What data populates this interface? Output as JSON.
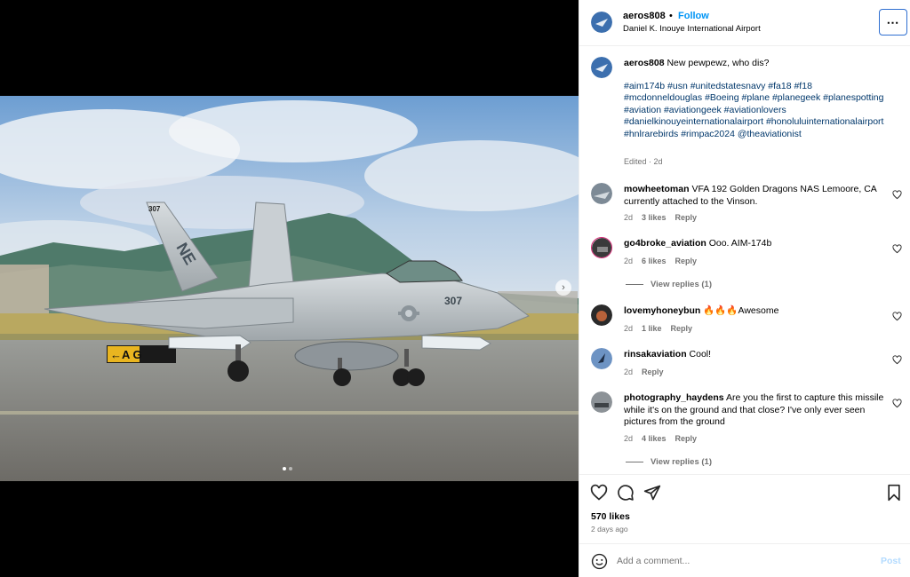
{
  "post": {
    "username": "aeros808",
    "separator": "•",
    "follow_label": "Follow",
    "location": "Daniel K. Inouye International Airport",
    "more_label": "⋯"
  },
  "caption": {
    "username": "aeros808",
    "text": "New pewpewz, who dis?",
    "hashtags": "#aim174b #usn #unitedstatesnavy #fa18 #f18 #mcdonneldouglas #Boeing #plane #planegeek #planespotting #aviation #aviationgeek #aviationlovers #danielkinouyeinternationalairport #honoluluinternationalairport #hnlrarebirds #rimpac2024 @theaviationist",
    "meta": "Edited · 2d"
  },
  "comments": [
    {
      "username": "mowheetoman",
      "text": "VFA 192 Golden Dragons NAS Lemoore, CA currently attached to the Vinson.",
      "age": "2d",
      "likes": "3 likes",
      "reply": "Reply"
    },
    {
      "username": "go4broke_aviation",
      "text": "Ooo. AIM-174b",
      "age": "2d",
      "likes": "6 likes",
      "reply": "Reply",
      "view_replies": "View replies (1)"
    },
    {
      "username": "lovemyhoneybun",
      "text": "🔥🔥🔥Awesome",
      "age": "2d",
      "likes": "1 like",
      "reply": "Reply"
    },
    {
      "username": "rinsakaviation",
      "text": "Cool!",
      "age": "2d",
      "reply": "Reply"
    },
    {
      "username": "photography_haydens",
      "text": "Are you the first to capture this missile while it's on the ground and that close? I've only ever seen pictures from the ground",
      "age": "2d",
      "likes": "4 likes",
      "reply": "Reply",
      "view_replies": "View replies (1)"
    }
  ],
  "footer": {
    "likes": "570 likes",
    "date": "2 days ago",
    "comment_placeholder": "Add a comment...",
    "post_label": "Post"
  },
  "photo": {
    "jet_modex": "307",
    "tail_code": "NE",
    "tail_number": "307",
    "sign_text": "←A G"
  },
  "colors": {
    "link": "#0095f6",
    "hashtag": "#00376b",
    "muted": "#737373"
  }
}
